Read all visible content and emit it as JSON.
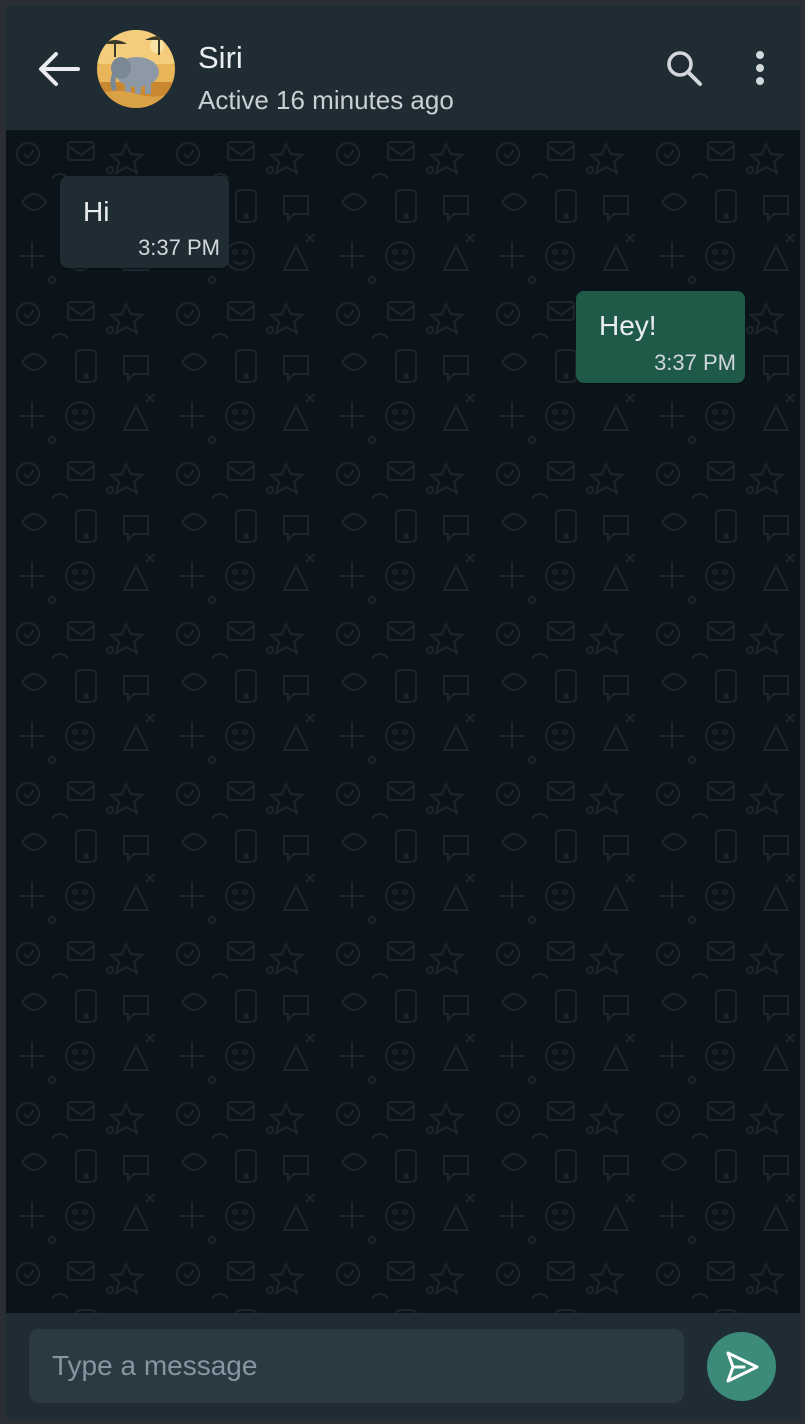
{
  "header": {
    "contact_name": "Siri",
    "contact_status": "Active 16 minutes ago",
    "back_icon": "arrow-left-icon",
    "search_icon": "search-icon",
    "menu_icon": "more-vertical-icon"
  },
  "messages": [
    {
      "direction": "incoming",
      "text": "Hi",
      "time": "3:37 PM"
    },
    {
      "direction": "outgoing",
      "text": "Hey!",
      "time": "3:37 PM"
    }
  ],
  "composer": {
    "placeholder": "Type a message",
    "value": "",
    "send_icon": "send-icon"
  },
  "colors": {
    "header_bg": "#202c33",
    "chat_bg": "#0b141a",
    "incoming_bubble": "#202c33",
    "outgoing_bubble": "#1f5a48",
    "send_button": "#3b8a7a",
    "primary_text": "#e9edef"
  }
}
